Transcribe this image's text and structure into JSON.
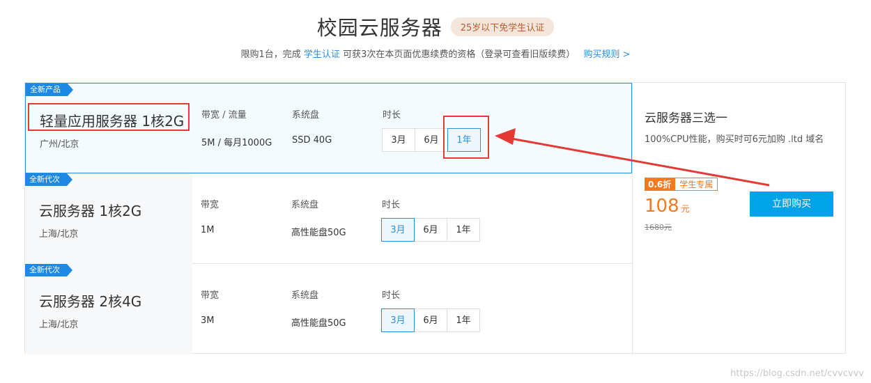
{
  "header": {
    "title": "校园云服务器",
    "badge": "25岁以下免学生认证",
    "sub_pre": "限购1台，完成",
    "sub_link": "学生认证",
    "sub_post": "可获3次在本页面优惠续费的资格（登录可查看旧版续费）",
    "rules_link": "购买规则 >"
  },
  "products": [
    {
      "tag": "全新产品",
      "name": "轻量应用服务器 1核2G",
      "region": "广州/北京",
      "bandwidth_label": "带宽 / 流量",
      "bandwidth": "5M / 每月1000G",
      "disk_label": "系统盘",
      "disk": "SSD 40G",
      "duration_label": "时长",
      "durations": [
        "3月",
        "6月",
        "1年"
      ]
    },
    {
      "tag": "全新代次",
      "name": "云服务器 1核2G",
      "region": "上海/北京",
      "bandwidth_label": "带宽",
      "bandwidth": "1M",
      "disk_label": "系统盘",
      "disk": "高性能盘50G",
      "duration_label": "时长",
      "durations": [
        "3月",
        "6月",
        "1年"
      ]
    },
    {
      "tag": "全新代次",
      "name": "云服务器 2核4G",
      "region": "上海/北京",
      "bandwidth_label": "带宽",
      "bandwidth": "3M",
      "disk_label": "系统盘",
      "disk": "高性能盘50G",
      "duration_label": "时长",
      "durations": [
        "3月",
        "6月",
        "1年"
      ]
    }
  ],
  "side": {
    "title": "云服务器三选一",
    "desc": "100%CPU性能，购买时可6元加购 .ltd 域名",
    "discount": "0.6折",
    "student_tag": "学生专属",
    "price": "108",
    "unit": "元",
    "old_price": "1680元",
    "buy_label": "立即购买"
  },
  "watermark": "https://blog.csdn.net/cvvcvvv",
  "colors": {
    "accent": "#2b8ee0",
    "orange": "#f5791f",
    "annotation": "#e53935"
  }
}
